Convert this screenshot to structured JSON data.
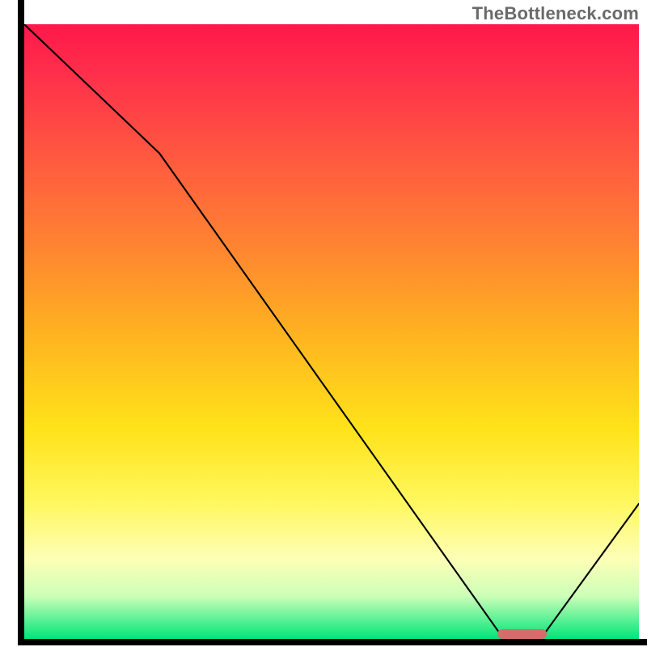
{
  "watermark": "TheBottleneck.com",
  "chart_data": {
    "type": "line",
    "title": "",
    "xlabel": "",
    "ylabel": "",
    "xlim": [
      0,
      100
    ],
    "ylim": [
      0,
      100
    ],
    "x": [
      0,
      22,
      78,
      84,
      100
    ],
    "values": [
      100,
      79,
      0,
      0,
      22
    ],
    "min_marker": {
      "x_start": 77,
      "x_end": 85,
      "thickness": 1.6
    },
    "gradient_stops": [
      {
        "pct": 0,
        "color": "#ff184a"
      },
      {
        "pct": 8,
        "color": "#ff2f4b"
      },
      {
        "pct": 22,
        "color": "#ff5a3f"
      },
      {
        "pct": 38,
        "color": "#ff8a2f"
      },
      {
        "pct": 52,
        "color": "#ffb81f"
      },
      {
        "pct": 66,
        "color": "#ffe31a"
      },
      {
        "pct": 78,
        "color": "#fff860"
      },
      {
        "pct": 87,
        "color": "#fdffb6"
      },
      {
        "pct": 93,
        "color": "#ccffb8"
      },
      {
        "pct": 100,
        "color": "#00e57a"
      }
    ]
  }
}
